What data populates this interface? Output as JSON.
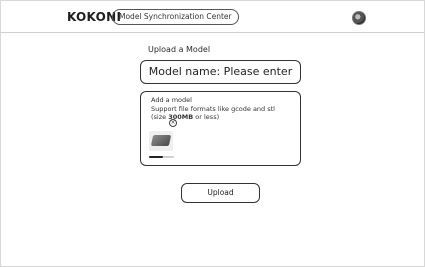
{
  "header": {
    "brand": "KOKONI",
    "subtitle": "Model Synchronization Center",
    "avatar_icon": "user-avatar-icon"
  },
  "upload": {
    "section_title": "Upload a Model",
    "model_name_placeholder": "Model name: Please enter",
    "dropzone": {
      "title": "Add a model",
      "formats_line": "Support file formats like gcode and stl",
      "size_prefix": "(size ",
      "size_value": "300MB",
      "size_suffix": " or less)",
      "thumbnail_icon": "model-thumbnail-icon",
      "remove_icon": "remove-icon",
      "progress": 0.55
    },
    "button_label": "Upload"
  },
  "colors": {
    "border": "#333333",
    "text": "#222222",
    "background": "#ffffff"
  }
}
